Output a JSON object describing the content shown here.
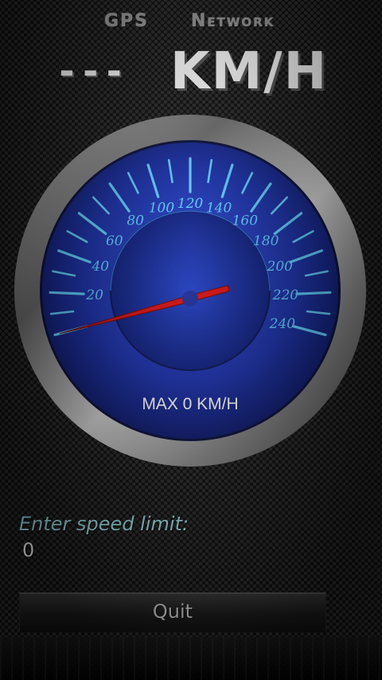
{
  "header": {
    "gps_label": "GPS",
    "network_label": "Network",
    "speed_value": "---",
    "unit": "KM/H"
  },
  "gauge": {
    "current_speed": 0,
    "max_label": "MAX 0 KM/H",
    "tick_labels": [
      "20",
      "40",
      "60",
      "80",
      "100",
      "120",
      "140",
      "160",
      "180",
      "200",
      "220",
      "240"
    ],
    "scale_max": 240,
    "colors": {
      "dial_blue": "#1a2fa8",
      "tick_cyan": "#5fd0ff",
      "needle_red": "#d81010"
    }
  },
  "speed_limit": {
    "label": "Enter speed limit:",
    "value": "0"
  },
  "actions": {
    "quit_label": "Quit"
  }
}
